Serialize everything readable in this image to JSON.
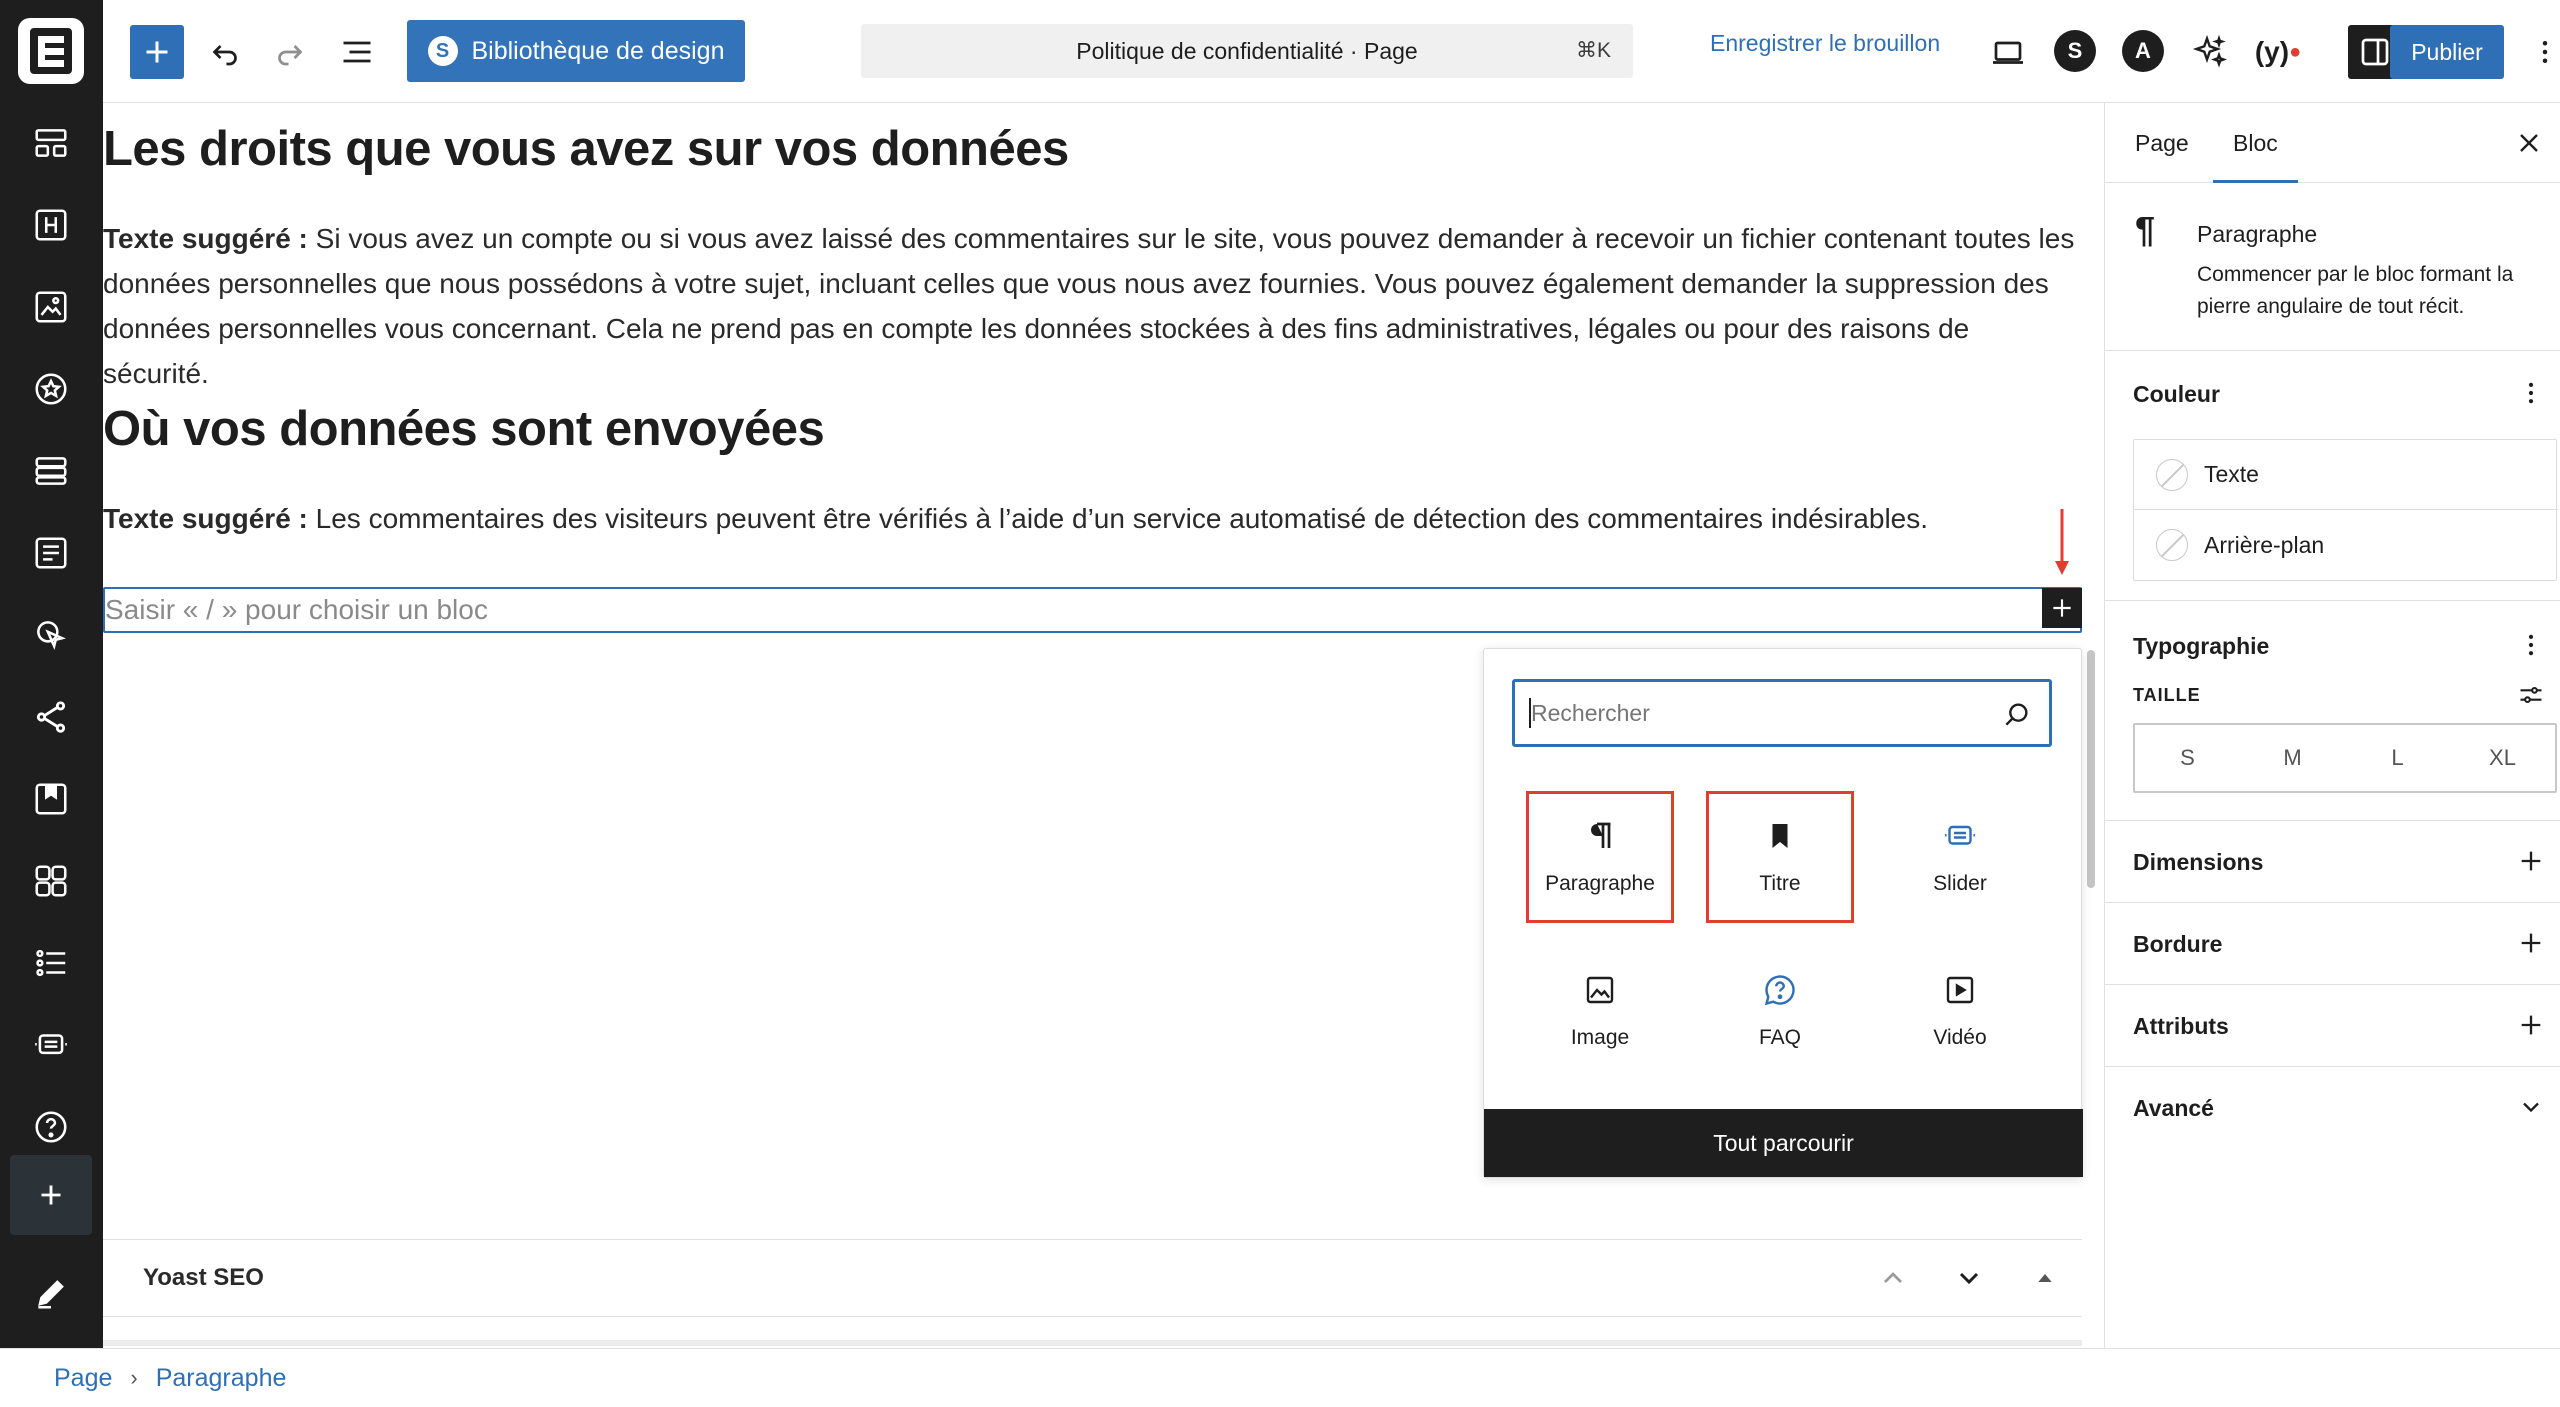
{
  "toolbar": {
    "design_library_label": "Bibliothèque de design",
    "command_title": "Politique de confidentialité · Page",
    "command_shortcut": "⌘K",
    "save_draft_label": "Enregistrer le brouillon",
    "publish_label": "Publier"
  },
  "content": {
    "heading1": "Les droits que vous avez sur vos données",
    "para1_label": "Texte suggéré :",
    "para1_line1": " Si vous avez un compte ou si vous avez laissé des commentaires sur le site, vous pouvez demander à recevoir un fichier contenant toutes les",
    "para1_line2": "données personnelles que nous possédons à votre sujet, incluant celles que vous nous avez fournies. Vous pouvez également demander la suppression des",
    "para1_line3": "données personnelles vous concernant. Cela ne prend pas en compte les données stockées à des fins administratives, légales ou pour des raisons de sécurité.",
    "heading2": "Où vos données sont envoyées",
    "para2_label": "Texte suggéré :",
    "para2_text": " Les commentaires des visiteurs peuvent être vérifiés à l’aide d’un service automatisé de détection des commentaires indésirables.",
    "block_placeholder": "Saisir « / » pour choisir un bloc"
  },
  "inserter": {
    "search_placeholder": "Rechercher",
    "blocks": [
      {
        "label": "Paragraphe",
        "icon": "paragraph-icon",
        "highlighted": true
      },
      {
        "label": "Titre",
        "icon": "bookmark-icon",
        "highlighted": true
      },
      {
        "label": "Slider",
        "icon": "slider-icon",
        "highlighted": false
      },
      {
        "label": "Image",
        "icon": "image-icon",
        "highlighted": false
      },
      {
        "label": "FAQ",
        "icon": "faq-icon",
        "highlighted": false
      },
      {
        "label": "Vidéo",
        "icon": "video-icon",
        "highlighted": false
      }
    ],
    "browse_all_label": "Tout parcourir"
  },
  "yoast": {
    "title": "Yoast SEO"
  },
  "sidebar": {
    "tabs": [
      "Page",
      "Bloc"
    ],
    "active_tab": "Bloc",
    "block_name": "Paragraphe",
    "block_description": "Commencer par le bloc formant la pierre angulaire de tout récit.",
    "color_title": "Couleur",
    "color_items": [
      "Texte",
      "Arrière-plan"
    ],
    "typography_title": "Typographie",
    "size_label": "TAILLE",
    "sizes": [
      "S",
      "M",
      "L",
      "XL"
    ],
    "dimensions_title": "Dimensions",
    "border_title": "Bordure",
    "attributes_title": "Attributs",
    "advanced_title": "Avancé"
  },
  "breadcrumb": {
    "items": [
      "Page",
      "Paragraphe"
    ]
  },
  "colors": {
    "accent": "#2f6fb5",
    "dark": "#1e1e1e",
    "highlight": "#e03e2f"
  }
}
